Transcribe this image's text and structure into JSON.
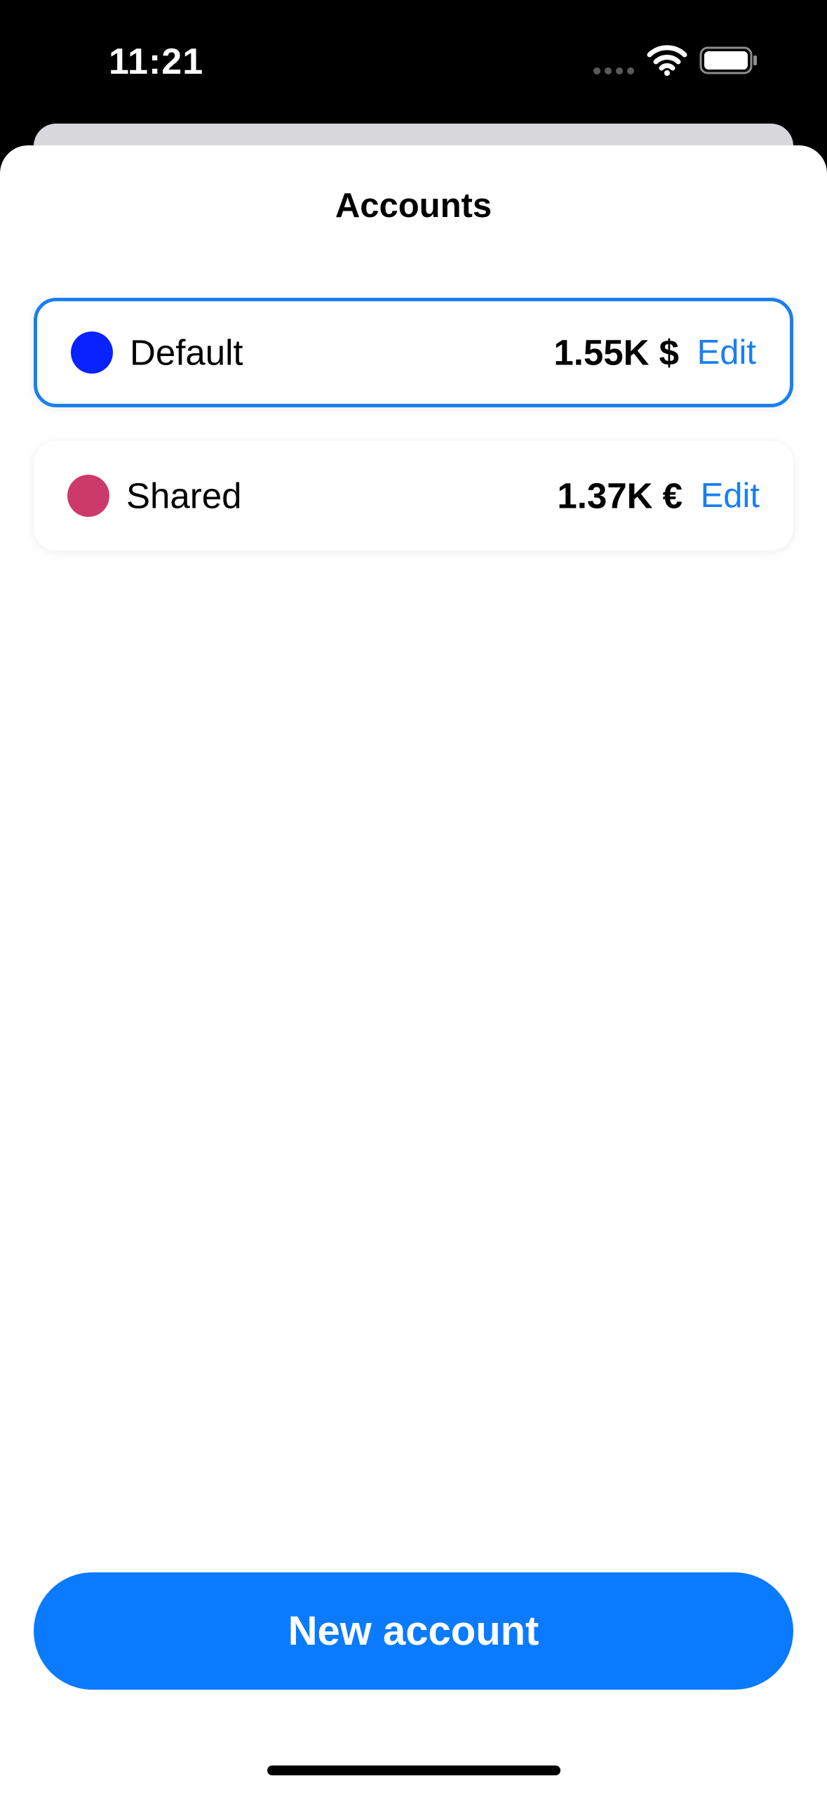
{
  "status_bar": {
    "time": "11:21",
    "icons": [
      "cellular-signal-icon",
      "wifi-icon",
      "battery-icon"
    ]
  },
  "sheet": {
    "title": "Accounts"
  },
  "accounts": [
    {
      "name": "Default",
      "balance": "1.55K $",
      "edit_label": "Edit",
      "color": "#0a22ff",
      "selected": true
    },
    {
      "name": "Shared",
      "balance": "1.37K €",
      "edit_label": "Edit",
      "color": "#cc3a6a",
      "selected": false
    }
  ],
  "actions": {
    "new_account_label": "New account"
  },
  "colors": {
    "accent": "#0a7aff",
    "link": "#1a7ff0",
    "background": "#ffffff"
  }
}
